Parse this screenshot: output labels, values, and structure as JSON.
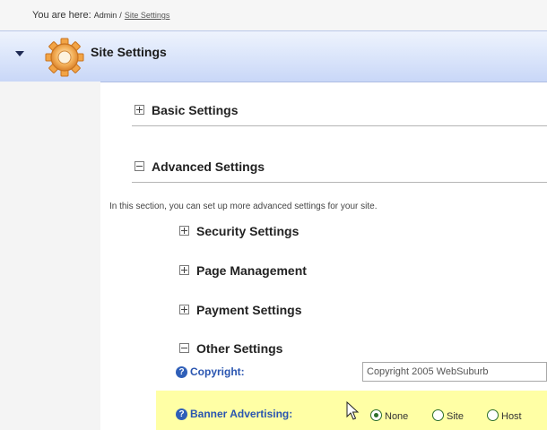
{
  "breadcrumb": {
    "prefix": "You are here:",
    "admin": "Admin",
    "separator": "/",
    "current": "Site Settings"
  },
  "header": {
    "title": "Site Settings",
    "icon": "gear-icon",
    "accent_color": "#c9d7f7"
  },
  "sections": {
    "basic": {
      "label": "Basic Settings",
      "expanded": false
    },
    "advanced": {
      "label": "Advanced Settings",
      "expanded": true,
      "description": "In this section, you can set up more advanced settings for your site."
    }
  },
  "subsections": {
    "security": {
      "label": "Security Settings",
      "expanded": false
    },
    "page_management": {
      "label": "Page Management",
      "expanded": false
    },
    "payment": {
      "label": "Payment Settings",
      "expanded": false
    },
    "other": {
      "label": "Other Settings",
      "expanded": true
    }
  },
  "fields": {
    "copyright": {
      "label": "Copyright:",
      "value": "Copyright 2005 WebSuburb"
    },
    "banner_advertising": {
      "label": "Banner Advertising:",
      "options": [
        "None",
        "Site",
        "Host"
      ],
      "selected": "None",
      "highlight_color": "#ffffa5"
    }
  }
}
